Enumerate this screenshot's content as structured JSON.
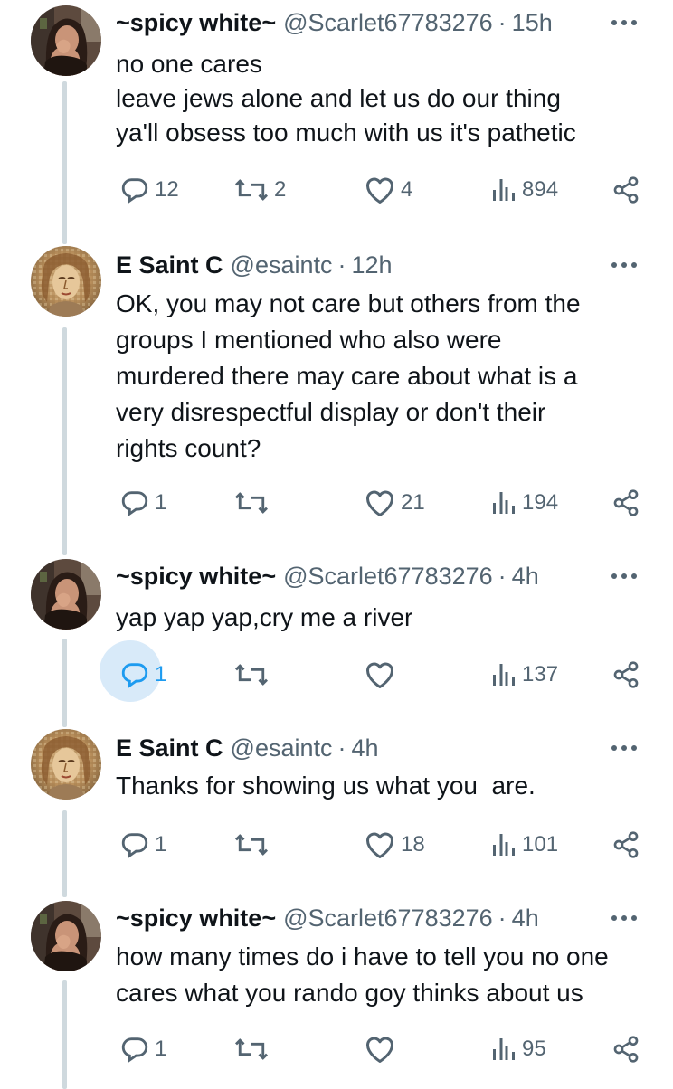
{
  "tweets": [
    {
      "name": "~spicy white~",
      "handle": "@Scarlet67783276",
      "separator": "·",
      "time": "15h",
      "avatar": "avatar-woman",
      "lines": [
        "no one cares",
        "leave jews alone and let us do our thing",
        "ya'll obsess too much with us it's pathetic"
      ],
      "replies": "12",
      "reposts": "2",
      "likes": "4",
      "views": "894",
      "reply_active": false
    },
    {
      "name": "E Saint C",
      "handle": "@esaintc",
      "separator": "·",
      "time": "12h",
      "avatar": "avatar-mosaic",
      "lines": [
        "OK, you may not care but others from the",
        "groups I mentioned who also were",
        "murdered there may care about what is a",
        "very disrespectful display or don't their",
        "rights count?"
      ],
      "replies": "1",
      "reposts": "",
      "likes": "21",
      "views": "194",
      "reply_active": false
    },
    {
      "name": "~spicy white~",
      "handle": "@Scarlet67783276",
      "separator": "·",
      "time": "4h",
      "avatar": "avatar-woman",
      "lines": [
        "yap yap yap,cry me a river"
      ],
      "replies": "1",
      "reposts": "",
      "likes": "",
      "views": "137",
      "reply_active": true
    },
    {
      "name": "E Saint C",
      "handle": "@esaintc",
      "separator": "·",
      "time": "4h",
      "avatar": "avatar-mosaic",
      "lines": [
        "Thanks for showing us what you  are."
      ],
      "replies": "1",
      "reposts": "",
      "likes": "18",
      "views": "101",
      "reply_active": false
    },
    {
      "name": "~spicy white~",
      "handle": "@Scarlet67783276",
      "separator": "·",
      "time": "4h",
      "avatar": "avatar-woman",
      "lines": [
        "how many times do i have to tell you no one",
        "cares what you rando goy thinks about us"
      ],
      "replies": "1",
      "reposts": "",
      "likes": "",
      "views": "95",
      "reply_active": false
    }
  ],
  "icons": {
    "reply": "reply-icon",
    "repost": "repost-icon",
    "like": "heart-icon",
    "views": "views-icon",
    "share": "share-icon",
    "more": "more-icon"
  },
  "colors": {
    "text": "#0f1419",
    "muted": "#536471",
    "thread_line": "#cfd9de",
    "reply_highlight": "#d8eaf9"
  }
}
